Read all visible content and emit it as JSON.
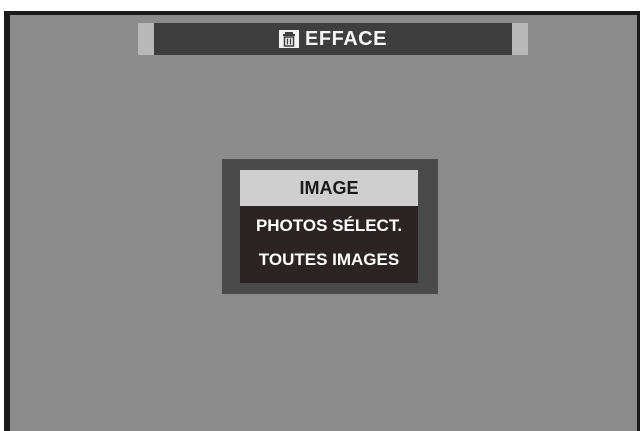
{
  "header": {
    "title": "EFFACE",
    "icon": "trash-icon"
  },
  "menu": {
    "items": [
      {
        "label": "IMAGE",
        "selected": true
      },
      {
        "label": "PHOTOS SÉLECT.",
        "selected": false
      },
      {
        "label": "TOUTES IMAGES",
        "selected": false
      }
    ]
  },
  "colors": {
    "screen_background": "#8c8c8c",
    "title_bar": "#3e3e3e",
    "menu_frame": "#4a4a4a",
    "menu_background": "#2c2424",
    "selected_item": "#cfcfcf"
  }
}
